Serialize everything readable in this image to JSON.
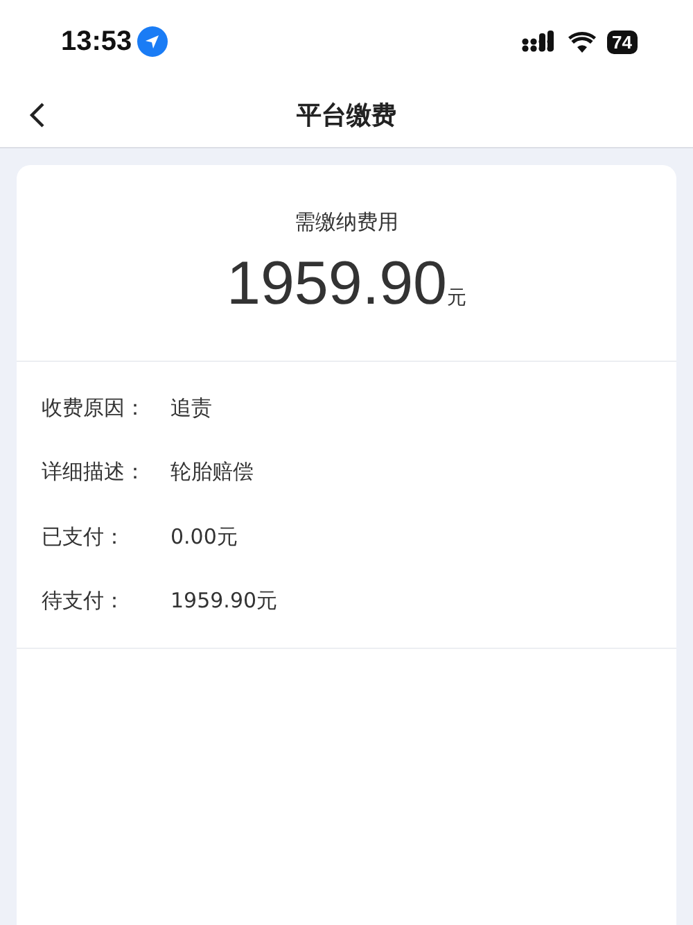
{
  "status_bar": {
    "time": "13:53",
    "battery": "74"
  },
  "nav": {
    "title": "平台缴费"
  },
  "summary": {
    "label": "需缴纳费用",
    "amount": "1959.90",
    "unit": "元"
  },
  "details": [
    {
      "label": "收费原因：",
      "value": "追责"
    },
    {
      "label": "详细描述：",
      "value": "轮胎赔偿"
    },
    {
      "label": "已支付：",
      "value": "0.00元"
    },
    {
      "label": "待支付：",
      "value": "1959.90元"
    }
  ]
}
